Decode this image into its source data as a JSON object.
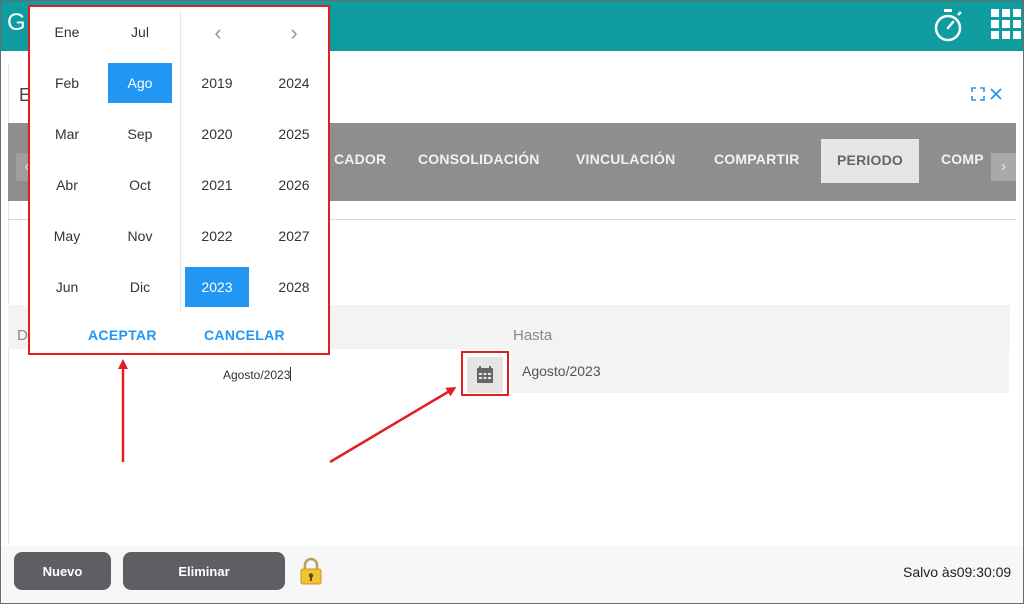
{
  "app": {
    "brand_letter": "G"
  },
  "panel": {
    "title_letter": "E"
  },
  "tabs": [
    {
      "label": "CADOR"
    },
    {
      "label": "CONSOLIDACIÓN"
    },
    {
      "label": "VINCULACIÓN"
    },
    {
      "label": "COMPARTIR"
    },
    {
      "label": "PERIODO",
      "active": true
    },
    {
      "label": "COMP"
    }
  ],
  "range": {
    "desde_label_visible": "D",
    "desde_value": "Agosto/2023",
    "hasta_label": "Hasta",
    "hasta_value": "Agosto/2023"
  },
  "picker": {
    "months": [
      "Ene",
      "Feb",
      "Mar",
      "Abr",
      "May",
      "Jun",
      "Jul",
      "Ago",
      "Sep",
      "Oct",
      "Nov",
      "Dic"
    ],
    "selected_month": "Ago",
    "years": [
      "2019",
      "2020",
      "2021",
      "2022",
      "2023",
      "2024",
      "2025",
      "2026",
      "2027",
      "2028"
    ],
    "selected_year": "2023",
    "prev_symbol": "‹",
    "next_symbol": "›",
    "accept_label": "ACEPTAR",
    "cancel_label": "CANCELAR"
  },
  "footer": {
    "new_label": "Nuevo",
    "delete_label": "Eliminar",
    "saved_text": "Salvo às09:30:09"
  },
  "colors": {
    "topbar": "#0f9c9f",
    "accent": "#2196f3",
    "annotation": "#e02020",
    "tabbar": "#8e8e8e",
    "button": "#5d5f63"
  },
  "icons": [
    "stopwatch-icon",
    "apps-grid-icon",
    "expand-icon",
    "close-icon",
    "calendar-icon",
    "lock-icon"
  ]
}
